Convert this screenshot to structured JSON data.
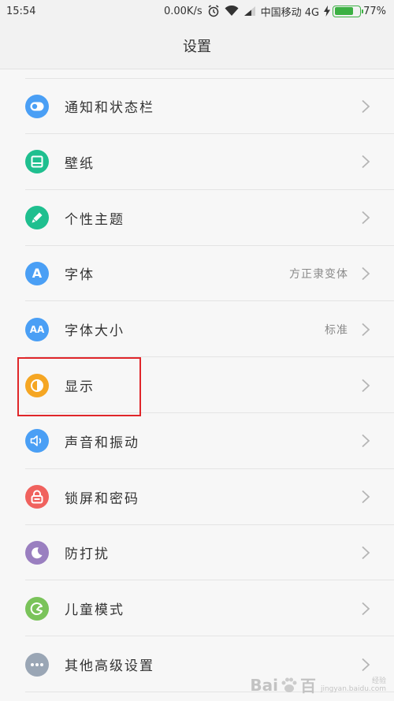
{
  "status_bar": {
    "time": "15:54",
    "net_speed": "0.00K/s",
    "carrier": "中国移动 4G",
    "battery_percent": "77%",
    "battery_level": 0.77
  },
  "header": {
    "title": "设置"
  },
  "items": [
    {
      "label": "通知和状态栏",
      "value": "",
      "icon": "toggle-icon",
      "color": "#4a9ff5"
    },
    {
      "label": "壁纸",
      "value": "",
      "icon": "wallpaper-icon",
      "color": "#1fbf8f"
    },
    {
      "label": "个性主题",
      "value": "",
      "icon": "brush-icon",
      "color": "#1fbf8f"
    },
    {
      "label": "字体",
      "value": "方正隶变体",
      "icon": "font-icon",
      "glyph": "A",
      "color": "#4a9ff5"
    },
    {
      "label": "字体大小",
      "value": "标准",
      "icon": "font-size-icon",
      "glyph": "AA",
      "color": "#4a9ff5"
    },
    {
      "label": "显示",
      "value": "",
      "icon": "brightness-icon",
      "color": "#f5a623"
    },
    {
      "label": "声音和振动",
      "value": "",
      "icon": "speaker-icon",
      "color": "#4a9ff5"
    },
    {
      "label": "锁屏和密码",
      "value": "",
      "icon": "lock-icon",
      "color": "#f0625e"
    },
    {
      "label": "防打扰",
      "value": "",
      "icon": "moon-icon",
      "color": "#9a7fc0"
    },
    {
      "label": "儿童模式",
      "value": "",
      "icon": "child-icon",
      "color": "#7ac35a"
    },
    {
      "label": "其他高级设置",
      "value": "",
      "icon": "more-icon",
      "color": "#9aa6b5"
    }
  ],
  "watermark": {
    "brand": "Bai",
    "brand2": "百",
    "sub1": "经验",
    "sub2": "jingyan.baidu.com"
  }
}
